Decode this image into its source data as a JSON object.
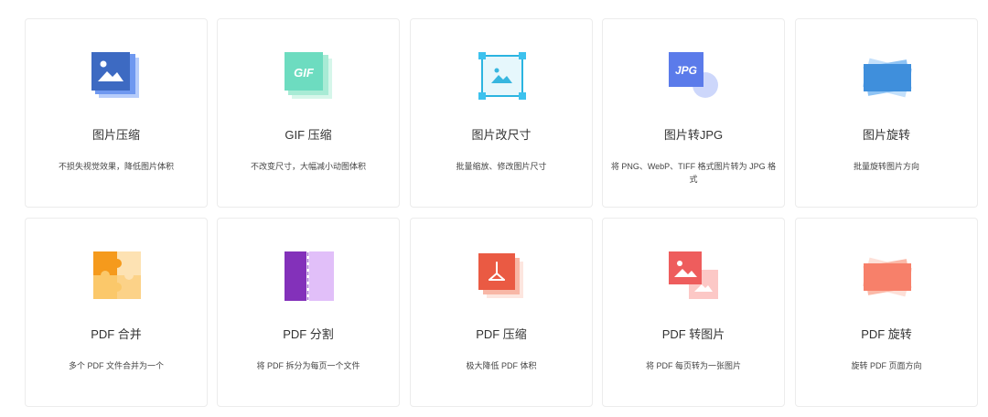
{
  "tools": [
    {
      "title": "图片压缩",
      "desc": "不损失视觉效果，降低图片体积",
      "icon": "image-compress-icon"
    },
    {
      "title": "GIF 压缩",
      "desc": "不改变尺寸，大幅减小动图体积",
      "icon": "gif-compress-icon",
      "icon_text": "GIF"
    },
    {
      "title": "图片改尺寸",
      "desc": "批量缩放、修改图片尺寸",
      "icon": "image-resize-icon"
    },
    {
      "title": "图片转JPG",
      "desc": "将 PNG、WebP、TIFF 格式图片转为 JPG 格式",
      "icon": "image-to-jpg-icon",
      "icon_text": "JPG"
    },
    {
      "title": "图片旋转",
      "desc": "批量旋转图片方向",
      "icon": "image-rotate-icon"
    },
    {
      "title": "PDF 合并",
      "desc": "多个 PDF 文件合并为一个",
      "icon": "pdf-merge-icon"
    },
    {
      "title": "PDF 分割",
      "desc": "将 PDF 拆分为每页一个文件",
      "icon": "pdf-split-icon"
    },
    {
      "title": "PDF 压缩",
      "desc": "极大降低 PDF 体积",
      "icon": "pdf-compress-icon"
    },
    {
      "title": "PDF 转图片",
      "desc": "将 PDF 每页转为一张图片",
      "icon": "pdf-to-image-icon"
    },
    {
      "title": "PDF 旋转",
      "desc": "旋转 PDF 页面方向",
      "icon": "pdf-rotate-icon"
    }
  ]
}
